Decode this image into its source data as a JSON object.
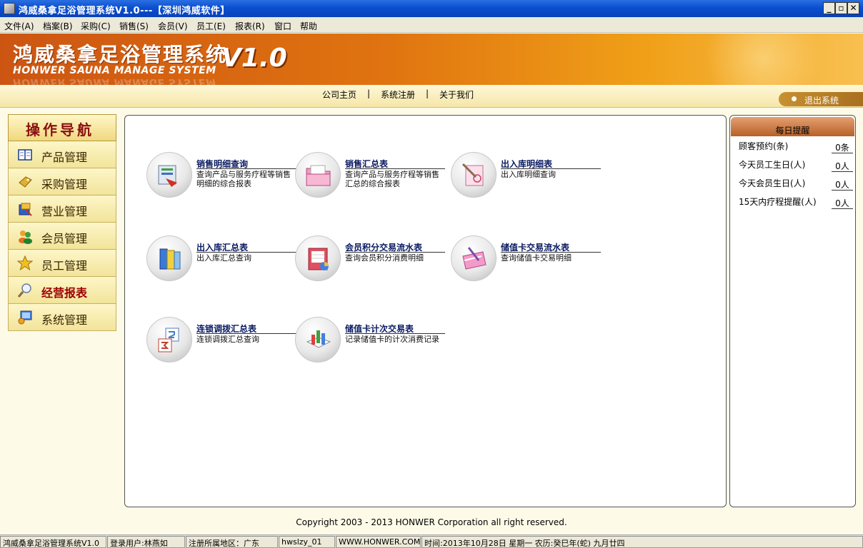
{
  "window": {
    "title": "鸿威桑拿足浴管理系统V1.0---【深圳鸿威软件】"
  },
  "menu": [
    "文件(A)",
    "档案(B)",
    "采购(C)",
    "销售(S)",
    "会员(V)",
    "员工(E)",
    "报表(R)",
    "窗口",
    "帮助"
  ],
  "banner": {
    "cn_title": "鸿威桑拿足浴管理系统",
    "en_title": "HONWER SAUNA MANAGE SYSTEM",
    "version": "V1.0"
  },
  "links": {
    "home": "公司主页",
    "register": "系统注册",
    "about": "关于我们",
    "separator": "|",
    "exit": "退出系统"
  },
  "nav": {
    "header": "操作导航",
    "items": [
      {
        "label": "产品管理",
        "icon": "book-icon"
      },
      {
        "label": "采购管理",
        "icon": "tag-icon"
      },
      {
        "label": "营业管理",
        "icon": "business-icon"
      },
      {
        "label": "会员管理",
        "icon": "members-icon"
      },
      {
        "label": "员工管理",
        "icon": "star-icon"
      },
      {
        "label": "经营报表",
        "icon": "magnifier-icon"
      },
      {
        "label": "系统管理",
        "icon": "computer-icon"
      }
    ]
  },
  "reports": [
    {
      "title": "销售明细查询",
      "desc": "查询产品与服务疗程等销售明细的综合报表",
      "icon": "sales-detail-icon"
    },
    {
      "title": "销售汇总表",
      "desc": "查询产品与服务疗程等销售汇总的综合报表",
      "icon": "folder-icon"
    },
    {
      "title": "出入库明细表",
      "desc": "出入库明细查询",
      "icon": "document-pen-icon"
    },
    {
      "title": "出入库汇总表",
      "desc": "出入库汇总查询",
      "icon": "books-icon"
    },
    {
      "title": "会员积分交易流水表",
      "desc": "查询会员积分消费明细",
      "icon": "chart-notebook-icon"
    },
    {
      "title": "储值卡交易流水表",
      "desc": "查询储值卡交易明细",
      "icon": "card-pen-icon"
    },
    {
      "title": "连锁调拨汇总表",
      "desc": "连锁调拨汇总查询",
      "icon": "numbers-icon"
    },
    {
      "title": "储值卡计次交易表",
      "desc": "记录储值卡的计次消费记录",
      "icon": "bar-chart-icon"
    }
  ],
  "reminder": {
    "header": "每日提醒",
    "items": [
      {
        "label": "顾客预约(条)",
        "value": "0条"
      },
      {
        "label": "今天员工生日(人)",
        "value": "0人"
      },
      {
        "label": "今天会员生日(人)",
        "value": "0人"
      },
      {
        "label": "15天内疗程提醒(人)",
        "value": "0人"
      }
    ]
  },
  "copyright": "Copyright 2003 - 2013 HONWER Corporation all right reserved.",
  "status": {
    "app": "鸿威桑拿足浴管理系统V1.0",
    "user": "登录用户:林燕如",
    "region": "注册所属地区：广东",
    "code": "hwslzy_01",
    "site": "WWW.HONWER.COM",
    "time": "时间:2013年10月28日   星期一   农历:癸巳年(蛇) 九月廿四"
  },
  "colors": {
    "banner_orange": "#e07410",
    "nav_bg": "#f2e49a",
    "active_label": "#9a0000",
    "title_blue": "#0a4fd0"
  }
}
